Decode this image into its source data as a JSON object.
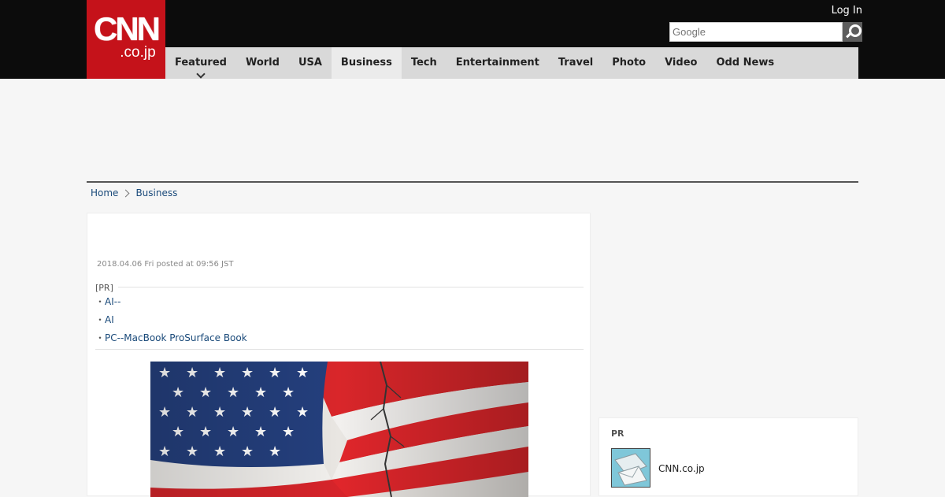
{
  "header": {
    "logo_main": "CNN",
    "logo_sub": ".co.jp",
    "login_label": "Log In",
    "search_placeholder": "Google"
  },
  "nav": {
    "items": [
      {
        "label": "Featured",
        "has_dropdown": true
      },
      {
        "label": "World"
      },
      {
        "label": "USA"
      },
      {
        "label": "Business",
        "active": true
      },
      {
        "label": "Tech"
      },
      {
        "label": "Entertainment"
      },
      {
        "label": "Travel"
      },
      {
        "label": "Photo"
      },
      {
        "label": "Video"
      },
      {
        "label": "Odd News"
      }
    ]
  },
  "breadcrumb": {
    "home": "Home",
    "current": "Business"
  },
  "article": {
    "posted": "2018.04.06 Fri posted at 09:56 JST",
    "pr_tag": "[PR]",
    "pr_links": [
      "AI--",
      "AI",
      "PC--MacBook ProSurface Book"
    ],
    "bullet": "・"
  },
  "sidebar": {
    "pr_tag": "PR",
    "pr_label": "CNN.co.jp"
  },
  "colors": {
    "brand_red": "#c5121a",
    "header_black": "#0c0c0c",
    "nav_gray": "#d9d9d9",
    "link_blue": "#1a4a7a"
  }
}
